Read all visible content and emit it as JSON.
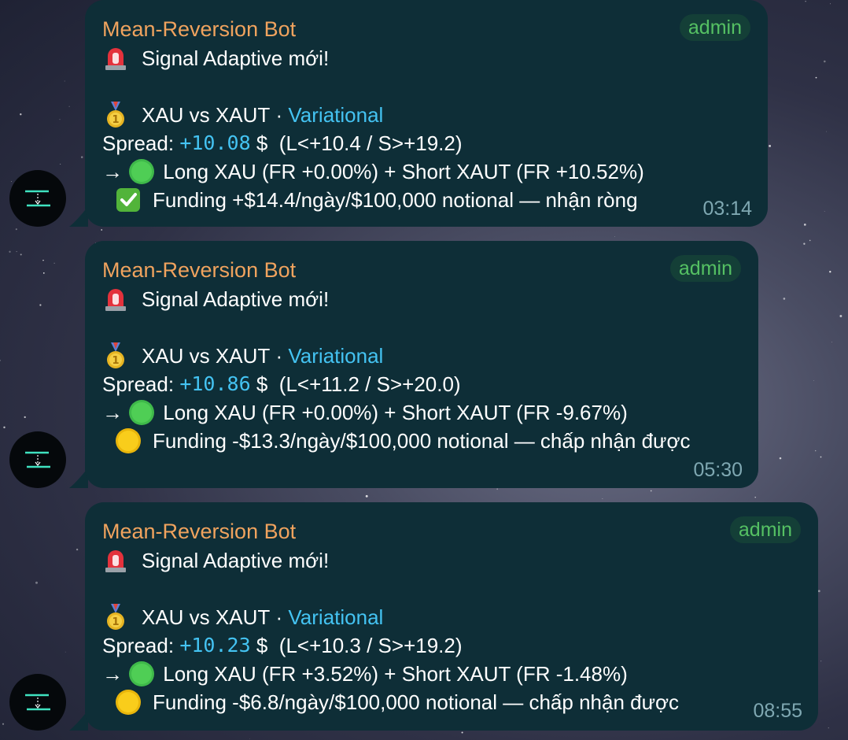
{
  "messages": [
    {
      "sender": "Mean-Reversion Bot",
      "role": "admin",
      "title": "Signal Adaptive mới!",
      "pair": "XAU vs XAUT",
      "separator": "·",
      "venue": "Variational",
      "spread_label": "Spread:",
      "spread_value": "+10.08",
      "spread_unit": "$",
      "spread_range": "(L<+10.4 / S>+19.2)",
      "arrow": "→",
      "position": "Long XAU (FR +0.00%) + Short XAUT (FR +10.52%)",
      "status_icon": "check-mark-icon",
      "funding": "Funding +$14.4/ngày/$100,000 notional — nhận ròng",
      "time": "03:14"
    },
    {
      "sender": "Mean-Reversion Bot",
      "role": "admin",
      "title": "Signal Adaptive mới!",
      "pair": "XAU vs XAUT",
      "separator": "·",
      "venue": "Variational",
      "spread_label": "Spread:",
      "spread_value": "+10.86",
      "spread_unit": "$",
      "spread_range": "(L<+11.2 / S>+20.0)",
      "arrow": "→",
      "position": "Long XAU (FR +0.00%) + Short XAUT (FR -9.67%)",
      "status_icon": "yellow-circle-icon",
      "funding": "Funding -$13.3/ngày/$100,000 notional — chấp nhận được",
      "time": "05:30"
    },
    {
      "sender": "Mean-Reversion Bot",
      "role": "admin",
      "title": "Signal Adaptive mới!",
      "pair": "XAU vs XAUT",
      "separator": "·",
      "venue": "Variational",
      "spread_label": "Spread:",
      "spread_value": "+10.23",
      "spread_unit": "$",
      "spread_range": "(L<+10.3 / S>+19.2)",
      "arrow": "→",
      "position": "Long XAU (FR +3.52%) + Short XAUT (FR -1.48%)",
      "status_icon": "yellow-circle-icon",
      "funding": "Funding -$6.8/ngày/$100,000 notional — chấp nhận được",
      "time": "08:55"
    }
  ],
  "colors": {
    "bubble": "#0e2e37",
    "sender": "#f0a35e",
    "admin_badge": "#55c163",
    "link": "#44c3f2",
    "time": "#7fa8b2"
  }
}
